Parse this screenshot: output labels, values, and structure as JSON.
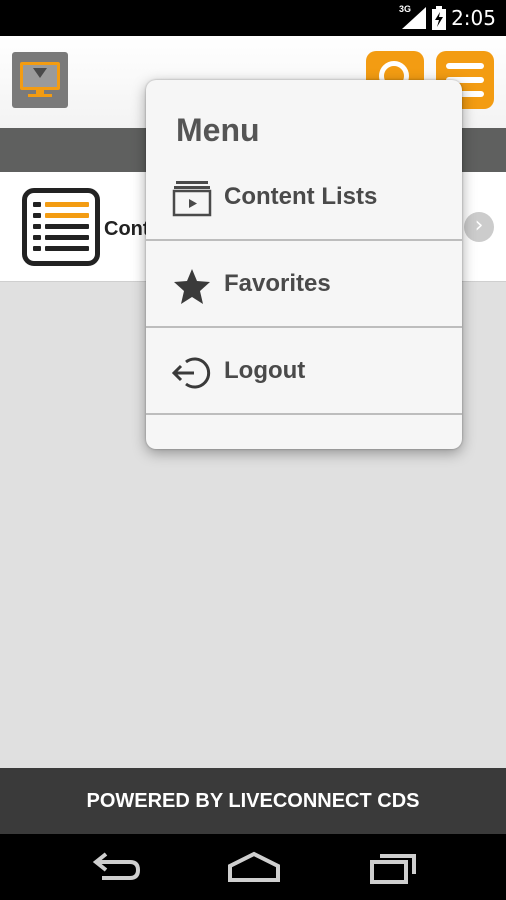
{
  "status_bar": {
    "network_type": "3G",
    "time": "2:05"
  },
  "header": {
    "logo_icon": "tv-screen-icon",
    "search_icon": "search-icon",
    "menu_icon": "hamburger-menu-icon",
    "accent_color": "#f39c12"
  },
  "content": {
    "row_label": "Cont",
    "row_icon": "list-icon",
    "chevron_icon": "chevron-right-icon"
  },
  "menu": {
    "title": "Menu",
    "items": [
      {
        "label": "Content Lists",
        "icon": "content-lists-icon"
      },
      {
        "label": "Favorites",
        "icon": "star-icon"
      },
      {
        "label": "Logout",
        "icon": "logout-icon"
      }
    ]
  },
  "footer": {
    "text": "POWERED BY LIVECONNECT CDS"
  },
  "nav": {
    "back_icon": "back-icon",
    "home_icon": "home-icon",
    "recents_icon": "recent-apps-icon"
  }
}
